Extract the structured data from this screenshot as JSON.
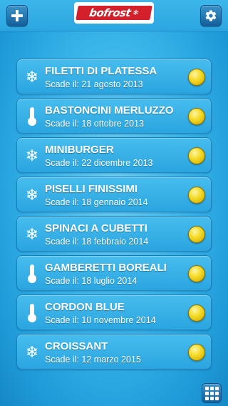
{
  "header": {
    "logo_text": "bofrost",
    "add_icon": "plus-icon",
    "settings_icon": "gear-icon"
  },
  "items": [
    {
      "title": "FILETTI DI PLATESSA",
      "subtitle": "Scade il: 21 agosto 2013",
      "icon": "snowflake-icon",
      "status_color": "#f2d21c"
    },
    {
      "title": "BASTONCINI MERLUZZO",
      "subtitle": "Scade il: 18 ottobre 2013",
      "icon": "thermometer-icon",
      "status_color": "#f2d21c"
    },
    {
      "title": "MINIBURGER",
      "subtitle": "Scade il: 22 dicembre 2013",
      "icon": "snowflake-icon",
      "status_color": "#f2d21c"
    },
    {
      "title": "PISELLI FINISSIMI",
      "subtitle": "Scade il: 18 gennaio 2014",
      "icon": "snowflake-icon",
      "status_color": "#f2d21c"
    },
    {
      "title": "SPINACI A CUBETTI",
      "subtitle": "Scade il: 18 febbraio 2014",
      "icon": "snowflake-icon",
      "status_color": "#f2d21c"
    },
    {
      "title": "GAMBERETTI BOREALI",
      "subtitle": "Scade il: 18 luglio 2014",
      "icon": "thermometer-icon",
      "status_color": "#f2d21c"
    },
    {
      "title": "CORDON BLUE",
      "subtitle": "Scade il: 10 novembre 2014",
      "icon": "thermometer-icon",
      "status_color": "#f2d21c"
    },
    {
      "title": "CROISSANT",
      "subtitle": "Scade il: 12 marzo 2015",
      "icon": "snowflake-icon",
      "status_color": "#f2d21c"
    }
  ],
  "footer": {
    "grid_icon": "grid-icon"
  },
  "colors": {
    "background": "#39b5ea",
    "brand_red": "#d4202a",
    "button_blue": "#14609c"
  }
}
